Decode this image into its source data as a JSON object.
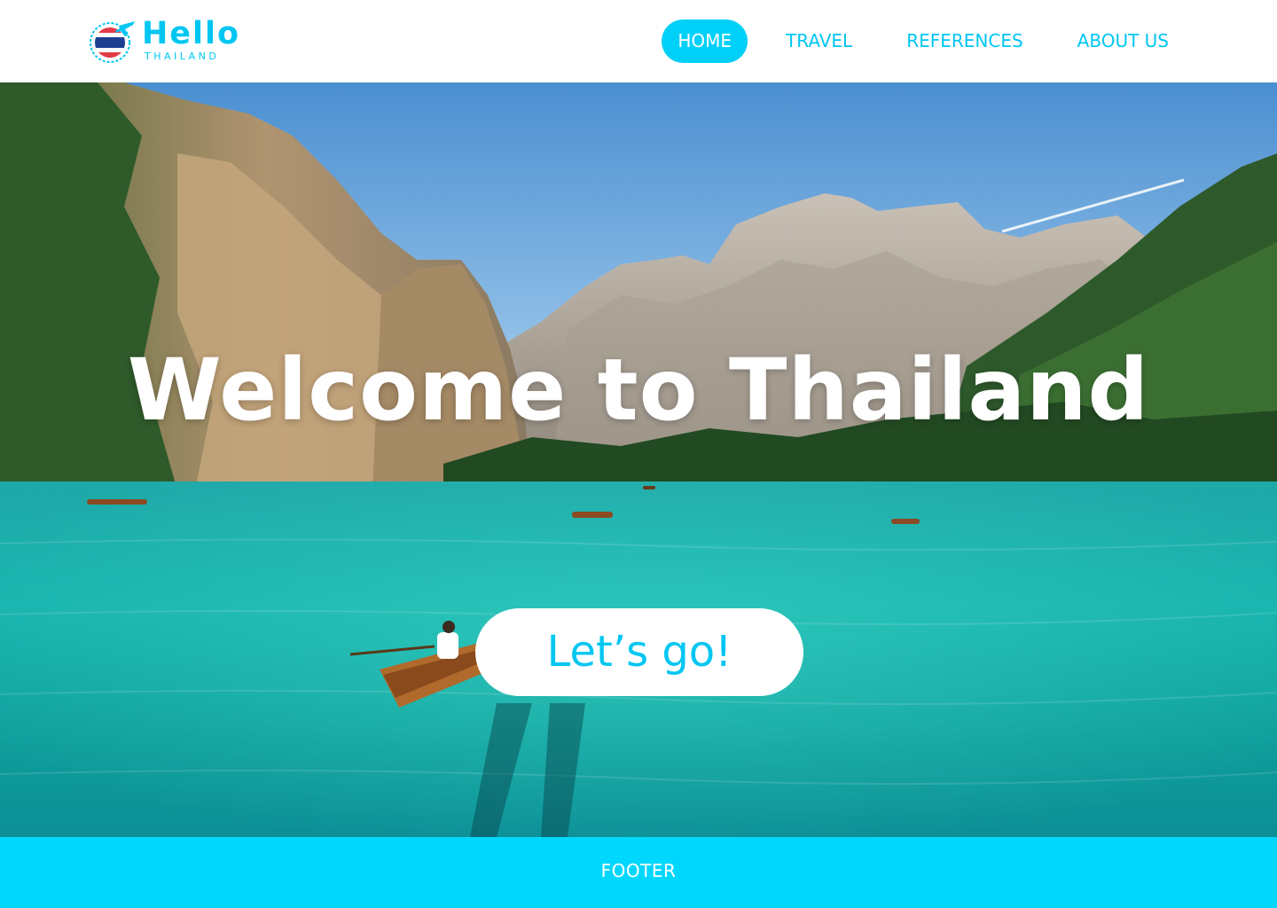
{
  "brand": {
    "name": "Hello",
    "tagline": "THAILAND",
    "primary_color": "#00c6f2",
    "accent_color": "#00d7ff",
    "flag_colors": [
      "#e23a47",
      "#ffffff",
      "#1c3f8f"
    ]
  },
  "nav": {
    "items": [
      {
        "label": "HOME",
        "active": true
      },
      {
        "label": "TRAVEL",
        "active": false
      },
      {
        "label": "REFERENCES",
        "active": false
      },
      {
        "label": "ABOUT US",
        "active": false
      }
    ]
  },
  "hero": {
    "title": "Welcome to Thailand",
    "cta_label": "Let’s go!",
    "image_description": "mountain-lake-with-boats"
  },
  "footer": {
    "label": "FOOTER"
  },
  "icons": {
    "logo": "airplane-badge-icon"
  }
}
